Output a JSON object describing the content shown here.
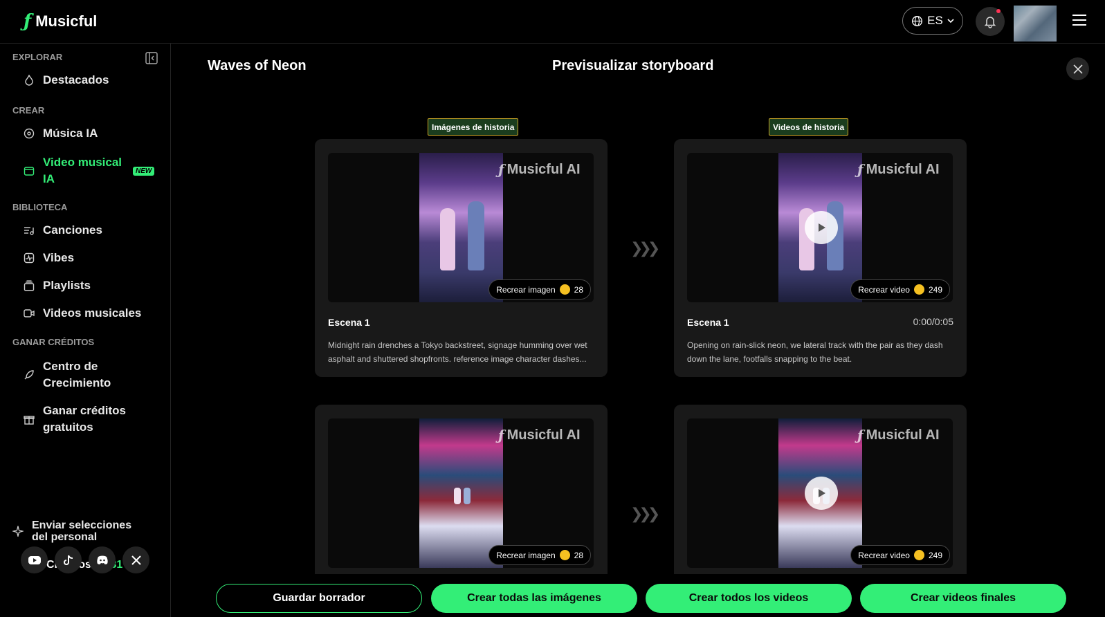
{
  "app": {
    "name": "Musicful",
    "lang": "ES"
  },
  "sidebar": {
    "sections": [
      {
        "title": "EXPLORAR"
      },
      {
        "title": "CREAR"
      },
      {
        "title": "BIBLIOTECA"
      },
      {
        "title": "GANAR CRÉDITOS"
      }
    ],
    "items": [
      {
        "label": "Destacados",
        "icon": "flame-icon"
      },
      {
        "label": "Música IA",
        "icon": "disc-icon"
      },
      {
        "label": "Video musical IA",
        "icon": "video-icon",
        "badge": "NEW"
      },
      {
        "label": "Canciones",
        "icon": "song-list-icon"
      },
      {
        "label": "Vibes",
        "icon": "vibes-icon"
      },
      {
        "label": "Playlists",
        "icon": "playlist-icon"
      },
      {
        "label": "Videos musicales",
        "icon": "music-video-icon"
      },
      {
        "label": "Centro de Crecimiento",
        "icon": "rocket-icon"
      },
      {
        "label": "Ganar créditos gratuitos",
        "icon": "gift-icon"
      }
    ],
    "feedback": "Enviar selecciones del personal",
    "credits_label": "Créditos:",
    "credits_value": "1631",
    "socials": [
      "youtube-icon",
      "tiktok-icon",
      "discord-icon",
      "x-icon"
    ]
  },
  "main": {
    "title": "Waves of Neon",
    "center_title": "Previsualizar storyboard",
    "column_labels": {
      "images": "Imágenes de historia",
      "videos": "Videos de historia"
    },
    "watermark": "Musicful AI",
    "scenes": [
      {
        "title": "Escena 1",
        "image_desc": "Midnight rain drenches a Tokyo backstreet, signage humming over wet asphalt and shuttered shopfronts. reference image character dashes...",
        "video_desc": "Opening on rain-slick neon, we lateral track with the pair as they dash down the lane, footfalls snapping to the beat.",
        "time": "0:00/0:05",
        "regen_image": "Recrear imagen",
        "regen_image_cost": "28",
        "regen_video": "Recrear video",
        "regen_video_cost": "249"
      },
      {
        "regen_image": "Recrear imagen",
        "regen_image_cost": "28",
        "regen_video": "Recrear video",
        "regen_video_cost": "249"
      }
    ]
  },
  "actions": {
    "save_draft": "Guardar borrador",
    "create_images": "Crear todas las imágenes",
    "create_videos": "Crear todos los videos",
    "create_final": "Crear videos finales"
  },
  "colors": {
    "accent": "#33ee77",
    "card_bg": "#191919",
    "coin": "#f5c021"
  }
}
